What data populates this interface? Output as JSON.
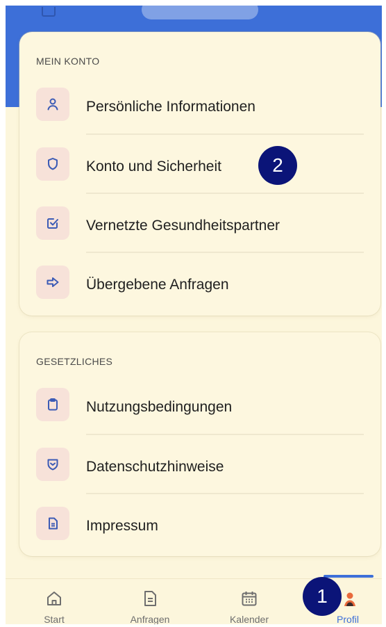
{
  "colors": {
    "header_blue": "#3d6fd8",
    "background": "#fcf6dc",
    "icon_background": "#f7e2d9",
    "icon_color": "#3c5bb5",
    "badge": "#0b1478",
    "active_tab": "#3d6fd8"
  },
  "account_section": {
    "title": "MEIN KONTO",
    "items": [
      {
        "label": "Persönliche Informationen",
        "icon": "user-icon"
      },
      {
        "label": "Konto und Sicherheit",
        "icon": "shield-icon"
      },
      {
        "label": "Vernetzte Gesundheitspartner",
        "icon": "checkbox-icon"
      },
      {
        "label": "Übergebene Anfragen",
        "icon": "arrow-right-icon"
      }
    ]
  },
  "legal_section": {
    "title": "GESETZLICHES",
    "items": [
      {
        "label": "Nutzungsbedingungen",
        "icon": "clipboard-icon"
      },
      {
        "label": "Datenschutzhinweise",
        "icon": "privacy-shield-icon"
      },
      {
        "label": "Impressum",
        "icon": "document-icon"
      }
    ]
  },
  "annotations": {
    "badge_1": "1",
    "badge_2": "2"
  },
  "tabbar": {
    "tabs": [
      {
        "label": "Start",
        "icon": "home-icon"
      },
      {
        "label": "Anfragen",
        "icon": "document-icon"
      },
      {
        "label": "Kalender",
        "icon": "calendar-icon"
      },
      {
        "label": "Profil",
        "icon": "profile-avatar-icon"
      }
    ],
    "active_tab": "Profil"
  }
}
